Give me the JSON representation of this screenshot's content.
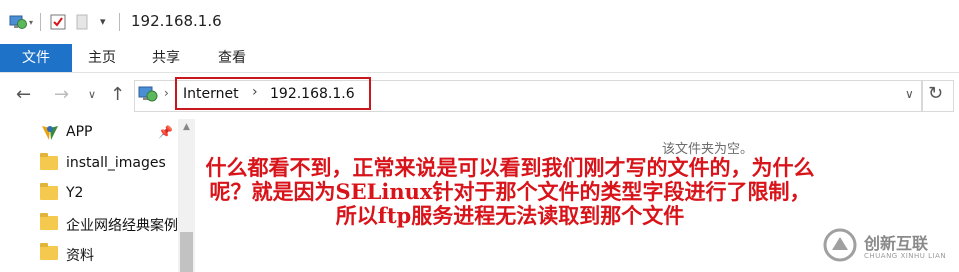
{
  "window": {
    "title": "192.168.1.6"
  },
  "ribbon": {
    "tabs": [
      "文件",
      "主页",
      "共享",
      "查看"
    ]
  },
  "address": {
    "crumbs": [
      "Internet",
      "192.168.1.6"
    ]
  },
  "sidebar": {
    "items": [
      {
        "label": "APP",
        "icon": "app-icon",
        "pinned": true
      },
      {
        "label": "install_images",
        "icon": "folder-icon"
      },
      {
        "label": "Y2",
        "icon": "folder-icon"
      },
      {
        "label": "企业网络经典案例",
        "icon": "folder-icon"
      },
      {
        "label": "资料",
        "icon": "folder-icon"
      }
    ]
  },
  "main": {
    "empty_message": "该文件夹为空。",
    "annotation": "什么都看不到，正常来说是可以看到我们刚才写的文件的，为什么呢？就是因为SELinux针对于那个文件的类型字段进行了限制，所以ftp服务进程无法读取到那个文件"
  },
  "watermark": {
    "text": "创新互联",
    "subtext": "CHUANG XINHU LIAN"
  },
  "colors": {
    "file_tab": "#1e73c8",
    "highlight_box": "#c8181e",
    "annotation": "#d8141a"
  }
}
